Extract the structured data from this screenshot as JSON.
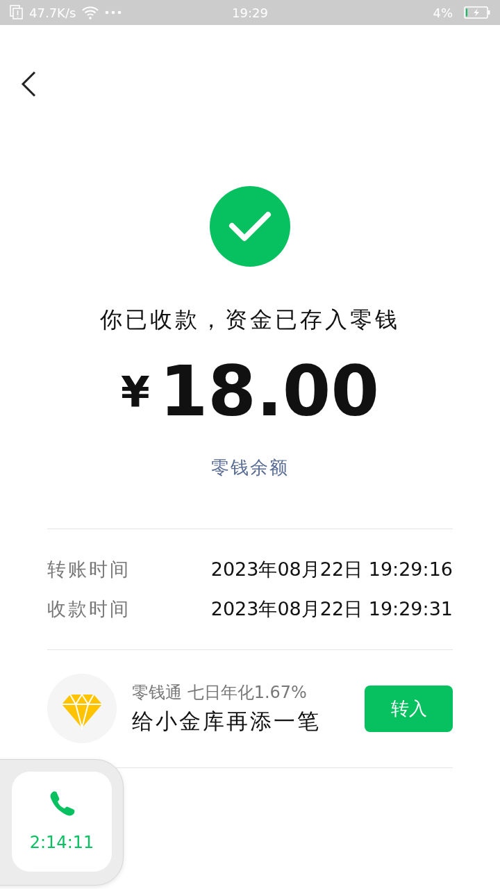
{
  "status_bar": {
    "speed": "47.7K/s",
    "time": "19:29",
    "battery_text": "4%"
  },
  "result": {
    "message": "你已收款，资金已存入零钱",
    "currency": "¥",
    "amount": "18.00",
    "link": "零钱余额"
  },
  "details": [
    {
      "label": "转账时间",
      "value": "2023年08月22日 19:29:16"
    },
    {
      "label": "收款时间",
      "value": "2023年08月22日 19:29:31"
    }
  ],
  "promo": {
    "subtitle": "零钱通 七日年化1.67%",
    "title": "给小金库再添一笔",
    "button": "转入"
  },
  "call_widget": {
    "duration": "2:14:11"
  }
}
